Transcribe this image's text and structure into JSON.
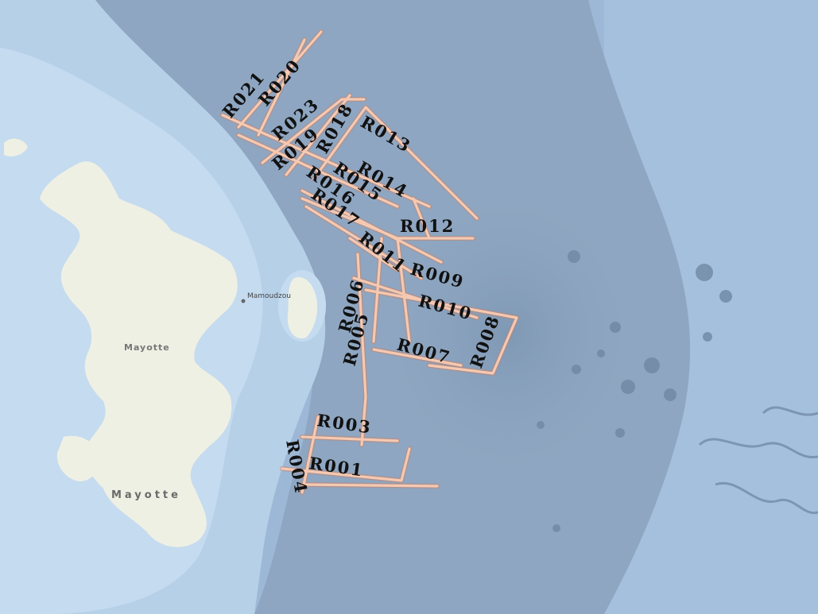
{
  "map": {
    "places": {
      "city": "Mamoudzou",
      "island_upper": "Mayotte",
      "island_lower": "Mayotte"
    },
    "colors": {
      "deep_ocean": "#9db8d6",
      "slope": "#8fa7c2",
      "shelf": "#b9d3ea",
      "lagoon": "#c6dcef",
      "land": "#eef0e4",
      "track_fill": "#f5c9b1",
      "track_outline": "#c9836a",
      "label": "#111111"
    },
    "track_labels": {
      "R001": "R001",
      "R003": "R003",
      "R004": "R004",
      "R005": "R005",
      "R006": "R006",
      "R007": "R007",
      "R008": "R008",
      "R009": "R009",
      "R010": "R010",
      "R011": "R011",
      "R012": "R012",
      "R013": "R013",
      "R014": "R014",
      "R015": "R015",
      "R016": "R016",
      "R017": "R017",
      "R018": "R018",
      "R019": "R019",
      "R020": "R020",
      "R021": "R021",
      "R023": "R023"
    }
  }
}
